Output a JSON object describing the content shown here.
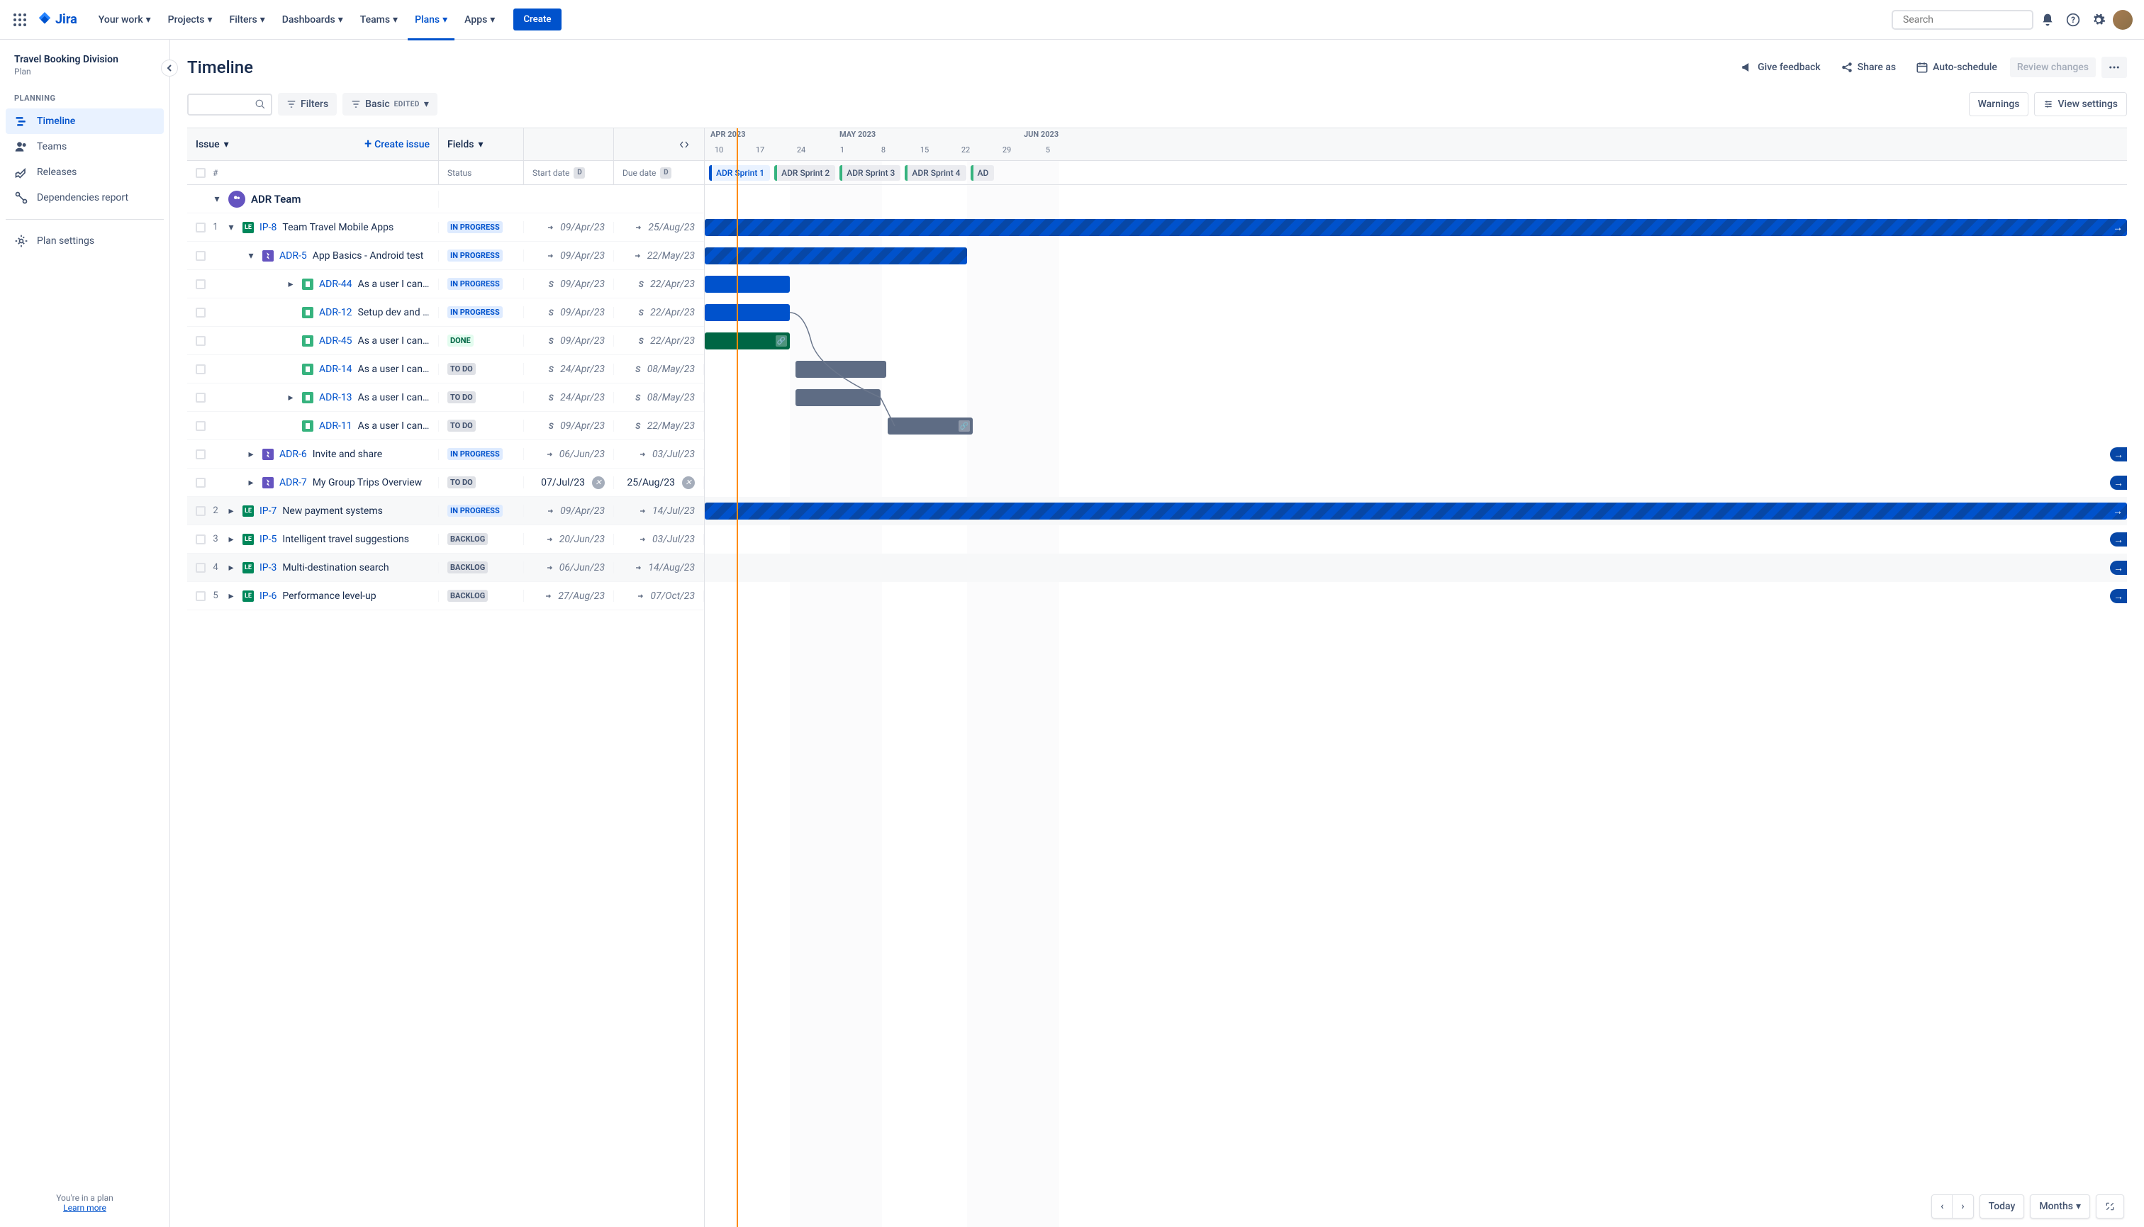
{
  "nav": {
    "logo": "Jira",
    "items": [
      "Your work",
      "Projects",
      "Filters",
      "Dashboards",
      "Teams",
      "Plans",
      "Apps"
    ],
    "active_index": 5,
    "create": "Create",
    "search_placeholder": "Search"
  },
  "sidebar": {
    "plan_name": "Travel Booking Division",
    "plan_sub": "Plan",
    "section": "PLANNING",
    "items": [
      {
        "label": "Timeline",
        "active": true
      },
      {
        "label": "Teams"
      },
      {
        "label": "Releases"
      },
      {
        "label": "Dependencies report"
      }
    ],
    "settings": "Plan settings",
    "footer1": "You're in a plan",
    "footer2": "Learn more"
  },
  "header": {
    "title": "Timeline",
    "feedback": "Give feedback",
    "share": "Share as",
    "auto": "Auto-schedule",
    "review": "Review changes"
  },
  "toolbar": {
    "filters": "Filters",
    "basic": "Basic",
    "edited": "EDITED",
    "warnings": "Warnings",
    "view": "View settings"
  },
  "columns": {
    "issue": "Issue",
    "create_issue": "Create issue",
    "fields": "Fields",
    "hash": "#",
    "status": "Status",
    "start": "Start date",
    "due": "Due date"
  },
  "timeline": {
    "months": [
      "APR 2023",
      "MAY 2023",
      "JUN 2023"
    ],
    "days": [
      "10",
      "17",
      "24",
      "1",
      "8",
      "15",
      "22",
      "29",
      "5"
    ],
    "sprints": [
      "ADR Sprint 1",
      "ADR Sprint 2",
      "ADR Sprint 3",
      "ADR Sprint 4",
      "AD"
    ]
  },
  "team_name": "ADR Team",
  "rows": [
    {
      "num": "1",
      "key": "IP-8",
      "type": "project",
      "summary": "Team Travel Mobile Apps",
      "status": "IN PROGRESS",
      "start": "09/Apr/23",
      "due": "25/Aug/23",
      "start_mode": "roll",
      "due_mode": "roll",
      "indent": 0,
      "expand": "open"
    },
    {
      "key": "ADR-5",
      "type": "epic",
      "summary": "App Basics - Android test",
      "status": "IN PROGRESS",
      "start": "09/Apr/23",
      "due": "22/May/23",
      "start_mode": "roll",
      "due_mode": "roll",
      "indent": 1,
      "expand": "open"
    },
    {
      "key": "ADR-44",
      "type": "story",
      "summary": "As a user I can up…",
      "status": "IN PROGRESS",
      "start": "09/Apr/23",
      "due": "22/Apr/23",
      "start_mode": "sprint",
      "due_mode": "sprint",
      "indent": 2,
      "expand": "closed"
    },
    {
      "key": "ADR-12",
      "type": "story",
      "summary": "Setup dev and and …",
      "status": "IN PROGRESS",
      "start": "09/Apr/23",
      "due": "22/Apr/23",
      "start_mode": "sprint",
      "due_mode": "sprint",
      "indent": 2
    },
    {
      "key": "ADR-45",
      "type": "story",
      "summary": "As a user I can ena…",
      "status": "DONE",
      "start": "09/Apr/23",
      "due": "22/Apr/23",
      "start_mode": "sprint",
      "due_mode": "sprint",
      "indent": 2
    },
    {
      "key": "ADR-14",
      "type": "story",
      "summary": "As a user I can cre…",
      "status": "TO DO",
      "start": "24/Apr/23",
      "due": "08/May/23",
      "start_mode": "sprint",
      "due_mode": "sprint",
      "indent": 2
    },
    {
      "key": "ADR-13",
      "type": "story",
      "summary": "As a user I can log i…",
      "status": "TO DO",
      "start": "24/Apr/23",
      "due": "08/May/23",
      "start_mode": "sprint",
      "due_mode": "sprint",
      "indent": 2,
      "expand": "closed"
    },
    {
      "key": "ADR-11",
      "type": "story",
      "summary": "As a user I can log i…",
      "status": "TO DO",
      "start": "09/Apr/23",
      "due": "22/May/23",
      "start_mode": "sprint",
      "due_mode": "sprint",
      "indent": 2
    },
    {
      "key": "ADR-6",
      "type": "epic",
      "summary": "Invite and share",
      "status": "IN PROGRESS",
      "start": "06/Jun/23",
      "due": "03/Jul/23",
      "start_mode": "roll",
      "due_mode": "roll",
      "indent": 1,
      "expand": "closed"
    },
    {
      "key": "ADR-7",
      "type": "epic",
      "summary": "My Group Trips Overview",
      "status": "TO DO",
      "start": "07/Jul/23",
      "due": "25/Aug/23",
      "start_mode": "plain",
      "due_mode": "plain",
      "indent": 1,
      "expand": "closed"
    },
    {
      "num": "2",
      "key": "IP-7",
      "type": "project",
      "summary": "New payment systems",
      "status": "IN PROGRESS",
      "start": "09/Apr/23",
      "due": "14/Jul/23",
      "start_mode": "roll",
      "due_mode": "roll",
      "indent": 0,
      "expand": "closed",
      "alt": true
    },
    {
      "num": "3",
      "key": "IP-5",
      "type": "project",
      "summary": "Intelligent travel suggestions",
      "status": "BACKLOG",
      "start": "20/Jun/23",
      "due": "03/Jul/23",
      "start_mode": "roll",
      "due_mode": "roll",
      "indent": 0,
      "expand": "closed"
    },
    {
      "num": "4",
      "key": "IP-3",
      "type": "project",
      "summary": "Multi-destination search",
      "status": "BACKLOG",
      "start": "06/Jun/23",
      "due": "14/Aug/23",
      "start_mode": "roll",
      "due_mode": "roll",
      "indent": 0,
      "expand": "closed",
      "alt": true
    },
    {
      "num": "5",
      "key": "IP-6",
      "type": "project",
      "summary": "Performance level-up",
      "status": "BACKLOG",
      "start": "27/Aug/23",
      "due": "07/Oct/23",
      "start_mode": "roll",
      "due_mode": "roll",
      "indent": 0,
      "expand": "closed"
    }
  ],
  "bottom": {
    "today": "Today",
    "range": "Months"
  }
}
